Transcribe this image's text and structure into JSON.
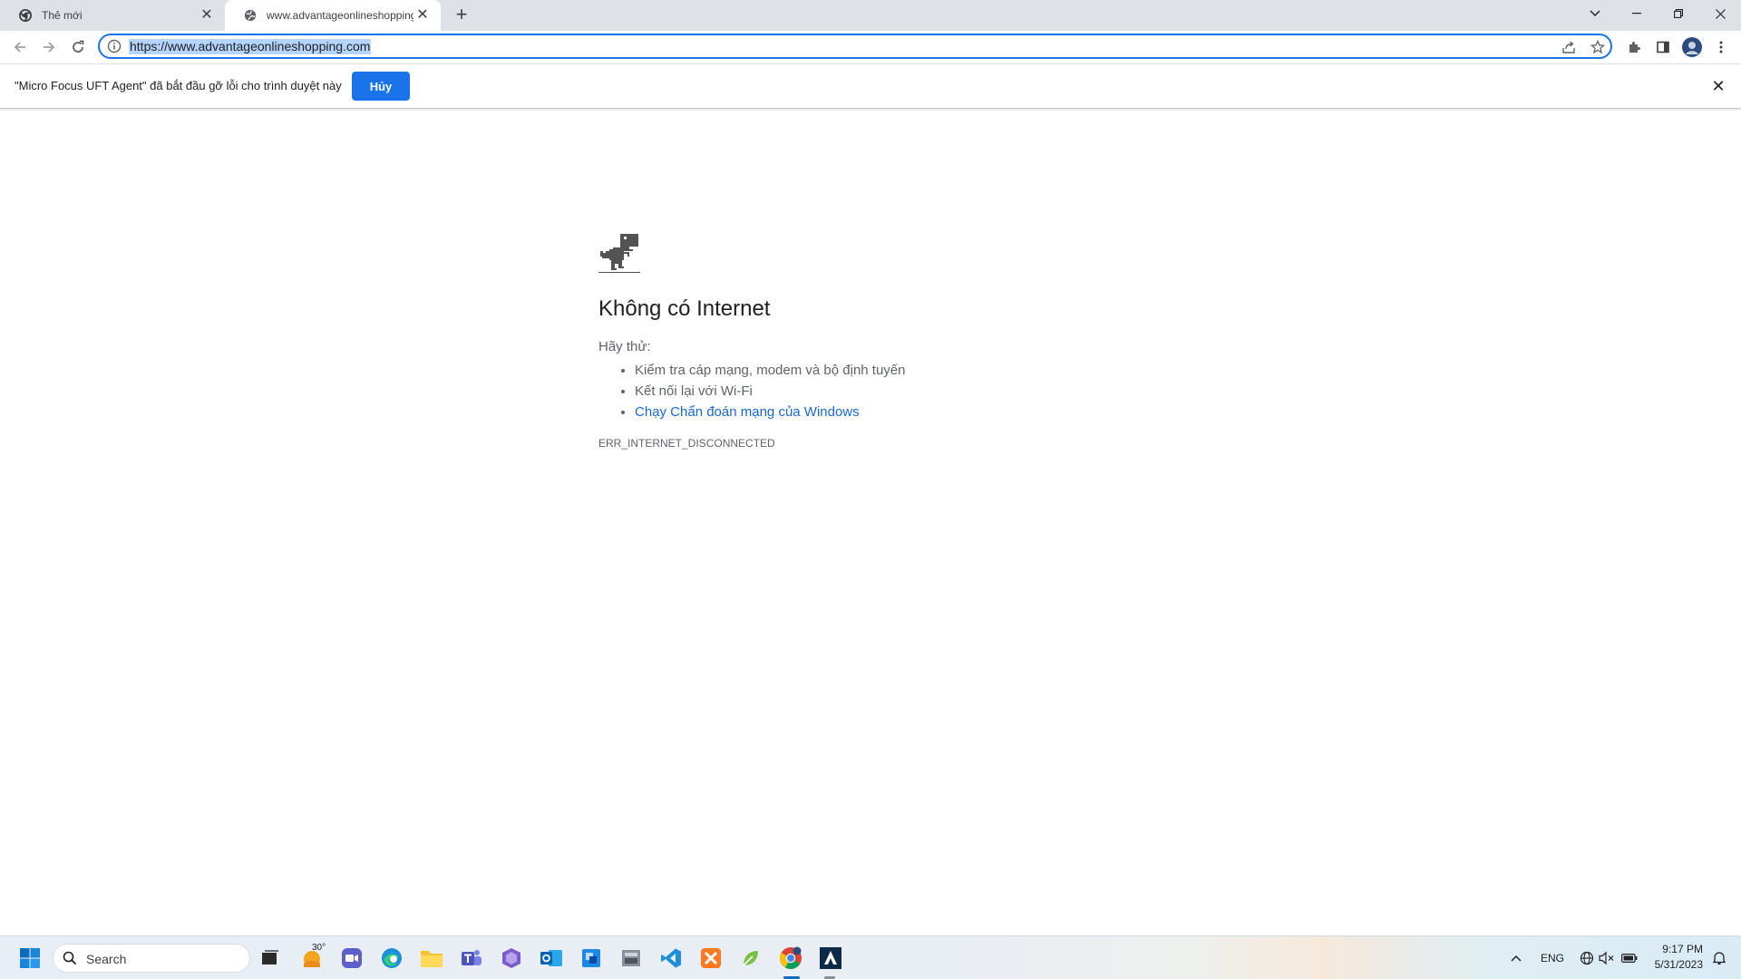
{
  "tabs": [
    {
      "title": "Thẻ mới",
      "icon": "chrome-icon"
    },
    {
      "title": "www.advantageonlineshopping.c",
      "icon": "globe-icon"
    }
  ],
  "toolbar": {
    "url": "https://www.advantageonlineshopping.com"
  },
  "infobar": {
    "message": "\"Micro Focus UFT Agent\" đã bắt đầu gỡ lỗi cho trình duyệt này",
    "cancel_label": "Hủy"
  },
  "error_page": {
    "title": "Không có Internet",
    "suggest_label": "Hãy thử:",
    "suggestions": [
      "Kiểm tra cáp mạng, modem và bộ định tuyến",
      "Kết nối lại với Wi-Fi",
      "Chạy Chẩn đoán mạng của Windows"
    ],
    "error_code": "ERR_INTERNET_DISCONNECTED"
  },
  "taskbar": {
    "search_placeholder": "Search",
    "weather_badge": "30°",
    "language": "ENG",
    "time": "9:17 PM",
    "date": "5/31/2023"
  },
  "colors": {
    "accent": "#1a73e8",
    "link": "#1967d2",
    "tabstrip": "#dee1e6",
    "url_selection": "#b4d4fb"
  }
}
